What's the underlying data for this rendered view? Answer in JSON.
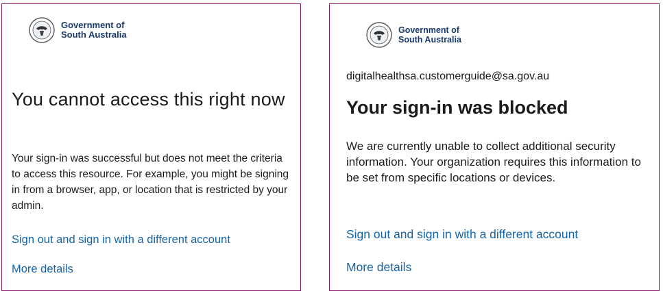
{
  "brand": {
    "line1": "Government of",
    "line2": "South Australia",
    "color": "#1a3a6b"
  },
  "panel_border_color": "#8c1d6e",
  "link_color": "#1564a9",
  "left_panel": {
    "heading": "You cannot access this right now",
    "body": "Your sign-in was successful but does not meet the criteria to access this resource. For example, you might be signing in from a browser, app, or location that is restricted by your admin.",
    "link_signout": "Sign out and sign in with a different account",
    "link_details": "More details"
  },
  "right_panel": {
    "email": "digitalhealthsa.customerguide@sa.gov.au",
    "heading": "Your sign-in was blocked",
    "body": "We are currently unable to collect additional security information. Your organization requires this information to be set from specific locations or devices.",
    "link_signout": "Sign out and sign in with a different account",
    "link_details": "More details"
  }
}
